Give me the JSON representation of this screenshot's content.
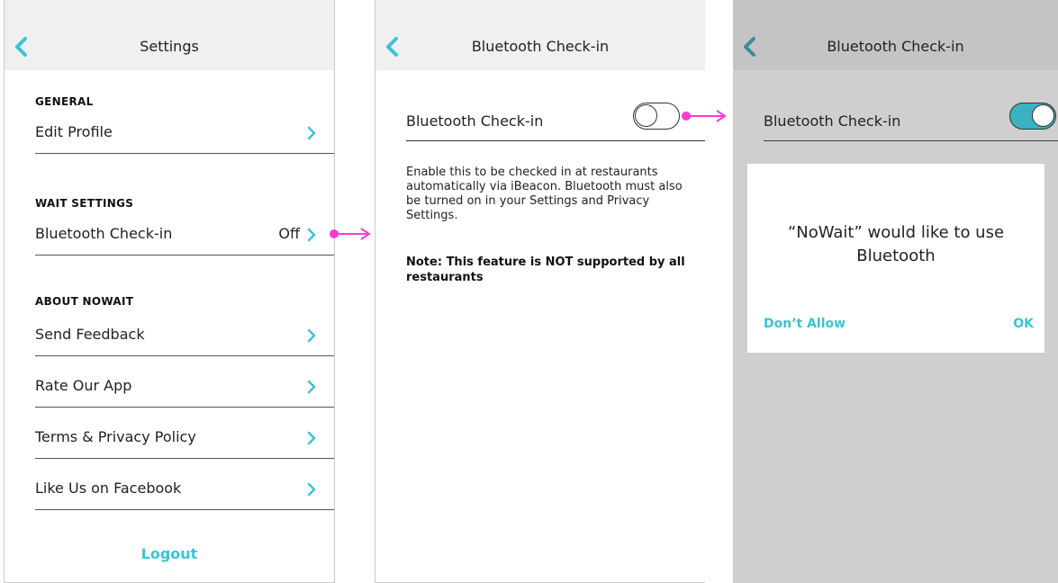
{
  "settings_screen": {
    "title": "Settings",
    "sections": {
      "general": "GENERAL",
      "wait": "WAIT SETTINGS",
      "about": "ABOUT NOWAIT"
    },
    "items": {
      "edit_profile": "Edit Profile",
      "bluetooth": "Bluetooth Check-in",
      "bluetooth_value": "Off",
      "send_feedback": "Send Feedback",
      "rate_app": "Rate Our App",
      "terms": "Terms & Privacy Policy",
      "facebook": "Like Us on Facebook"
    },
    "logout": "Logout"
  },
  "bluetooth_screen": {
    "title": "Bluetooth Check-in",
    "toggle_label": "Bluetooth Check-in",
    "toggle_state": "off",
    "description": "Enable this to be checked in at restaurants automatically via iBeacon. Bluetooth must also be turned on in your Settings and Privacy Settings.",
    "note": "Note: This feature is NOT supported by all restaurants"
  },
  "permission_screen": {
    "title": "Bluetooth Check-in",
    "toggle_label": "Bluetooth Check-in",
    "toggle_state": "on",
    "dialog": {
      "message": "“NoWait” would like to use Bluetooth",
      "deny": "Don’t Allow",
      "ok": "OK"
    }
  },
  "colors": {
    "accent": "#3cc3d2",
    "toggle_on": "#3bb3bf",
    "arrow": "#ff3ad6",
    "overlay": "#cfcfcf"
  },
  "icons": [
    "back-chevron-icon",
    "chevron-right-icon",
    "arrow-right-icon"
  ]
}
